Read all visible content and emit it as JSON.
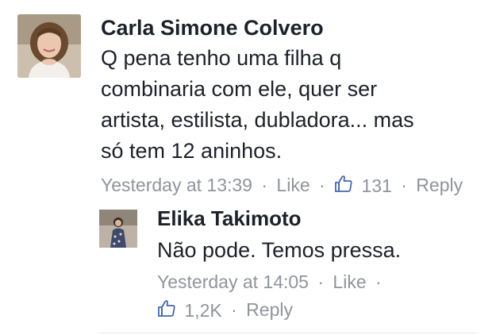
{
  "comment": {
    "author": "Carla Simone Colvero",
    "text": "Q pena tenho uma filha q\ncombinaria com ele, quer ser\nartista, estilista, dubladora... mas\nsó tem 12 aninhos.",
    "timestamp": "Yesterday at 13:39",
    "like_label": "Like",
    "like_count": "131",
    "reply_label": "Reply",
    "separator": "·"
  },
  "reply": {
    "author": "Elika Takimoto",
    "text": "Não pode. Temos pressa.",
    "timestamp": "Yesterday at 14:05",
    "like_label": "Like",
    "like_count": "1,2K",
    "reply_label": "Reply",
    "separator": "·"
  },
  "colors": {
    "name": "#1d2129",
    "meta": "#90949c",
    "like_icon": "#4267b2"
  },
  "icons": {
    "like": "thumbs-up-icon"
  }
}
